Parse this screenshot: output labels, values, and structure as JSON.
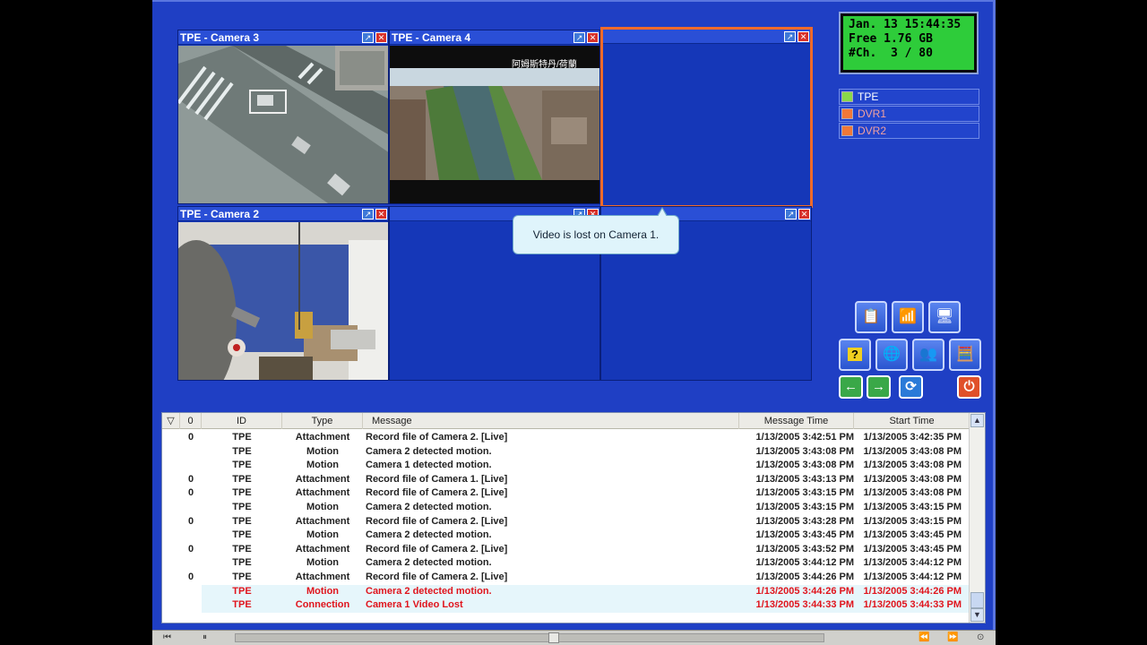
{
  "status": {
    "line1": "Jan. 13 15:44:35",
    "line2": "Free 1.76 GB",
    "line3": "#Ch.  3 / 80"
  },
  "servers": [
    {
      "label": "TPE",
      "state": "active"
    },
    {
      "label": "DVR1",
      "state": "inactive"
    },
    {
      "label": "DVR2",
      "state": "inactive"
    }
  ],
  "tiles": {
    "t1": {
      "title": "TPE - Camera 3"
    },
    "t2": {
      "title": "TPE - Camera 4"
    },
    "t3": {
      "title": ""
    },
    "t4": {
      "title": "TPE - Camera 2"
    },
    "t5": {
      "title": ""
    },
    "t6": {
      "title": ""
    }
  },
  "overlay_text": "阿姆斯特丹/荷蘭",
  "tooltip": "Video is lost on Camera 1.",
  "table": {
    "headers": {
      "flag": "▽",
      "attach": "0",
      "id": "ID",
      "type": "Type",
      "message": "Message",
      "msg_time": "Message Time",
      "start_time": "Start Time"
    },
    "rows": [
      {
        "attach": "0",
        "id": "TPE",
        "type": "Attachment",
        "message": "Record file of Camera 2. [Live]",
        "msg_time": "1/13/2005 3:42:51 PM",
        "start_time": "1/13/2005 3:42:35 PM",
        "alert": false
      },
      {
        "attach": "",
        "id": "TPE",
        "type": "Motion",
        "message": "Camera 2 detected motion.",
        "msg_time": "1/13/2005 3:43:08 PM",
        "start_time": "1/13/2005 3:43:08 PM",
        "alert": false
      },
      {
        "attach": "",
        "id": "TPE",
        "type": "Motion",
        "message": "Camera 1 detected motion.",
        "msg_time": "1/13/2005 3:43:08 PM",
        "start_time": "1/13/2005 3:43:08 PM",
        "alert": false
      },
      {
        "attach": "0",
        "id": "TPE",
        "type": "Attachment",
        "message": "Record file of Camera 1. [Live]",
        "msg_time": "1/13/2005 3:43:13 PM",
        "start_time": "1/13/2005 3:43:08 PM",
        "alert": false
      },
      {
        "attach": "0",
        "id": "TPE",
        "type": "Attachment",
        "message": "Record file of Camera 2. [Live]",
        "msg_time": "1/13/2005 3:43:15 PM",
        "start_time": "1/13/2005 3:43:08 PM",
        "alert": false
      },
      {
        "attach": "",
        "id": "TPE",
        "type": "Motion",
        "message": "Camera 2 detected motion.",
        "msg_time": "1/13/2005 3:43:15 PM",
        "start_time": "1/13/2005 3:43:15 PM",
        "alert": false
      },
      {
        "attach": "0",
        "id": "TPE",
        "type": "Attachment",
        "message": "Record file of Camera 2. [Live]",
        "msg_time": "1/13/2005 3:43:28 PM",
        "start_time": "1/13/2005 3:43:15 PM",
        "alert": false
      },
      {
        "attach": "",
        "id": "TPE",
        "type": "Motion",
        "message": "Camera 2 detected motion.",
        "msg_time": "1/13/2005 3:43:45 PM",
        "start_time": "1/13/2005 3:43:45 PM",
        "alert": false
      },
      {
        "attach": "0",
        "id": "TPE",
        "type": "Attachment",
        "message": "Record file of Camera 2. [Live]",
        "msg_time": "1/13/2005 3:43:52 PM",
        "start_time": "1/13/2005 3:43:45 PM",
        "alert": false
      },
      {
        "attach": "",
        "id": "TPE",
        "type": "Motion",
        "message": "Camera 2 detected motion.",
        "msg_time": "1/13/2005 3:44:12 PM",
        "start_time": "1/13/2005 3:44:12 PM",
        "alert": false
      },
      {
        "attach": "0",
        "id": "TPE",
        "type": "Attachment",
        "message": "Record file of Camera 2. [Live]",
        "msg_time": "1/13/2005 3:44:26 PM",
        "start_time": "1/13/2005 3:44:12 PM",
        "alert": false
      },
      {
        "attach": "",
        "id": "TPE",
        "type": "Motion",
        "message": "Camera 2 detected motion.",
        "msg_time": "1/13/2005 3:44:26 PM",
        "start_time": "1/13/2005 3:44:26 PM",
        "alert": true
      },
      {
        "attach": "",
        "id": "TPE",
        "type": "Connection",
        "message": "Camera 1 Video Lost",
        "msg_time": "1/13/2005 3:44:33 PM",
        "start_time": "1/13/2005 3:44:33 PM",
        "alert": true
      }
    ]
  },
  "player": {
    "first": "⏮",
    "pause": "⏸",
    "rewind": "⏪",
    "forward": "⏩",
    "settings": "⊙"
  },
  "colors": {
    "background": "#1f3fc4",
    "tile_bar": "#2a4fd6",
    "selected_border": "#f06a2a",
    "lcd": "#2ecc3a",
    "alert_text": "#e0141c"
  },
  "icons": [
    "notes-icon",
    "scheduler-icon",
    "network-icon",
    "help-icon",
    "globe-icon",
    "users-icon",
    "calculator-icon",
    "back-arrow-icon",
    "forward-arrow-icon",
    "refresh-icon",
    "power-icon"
  ]
}
